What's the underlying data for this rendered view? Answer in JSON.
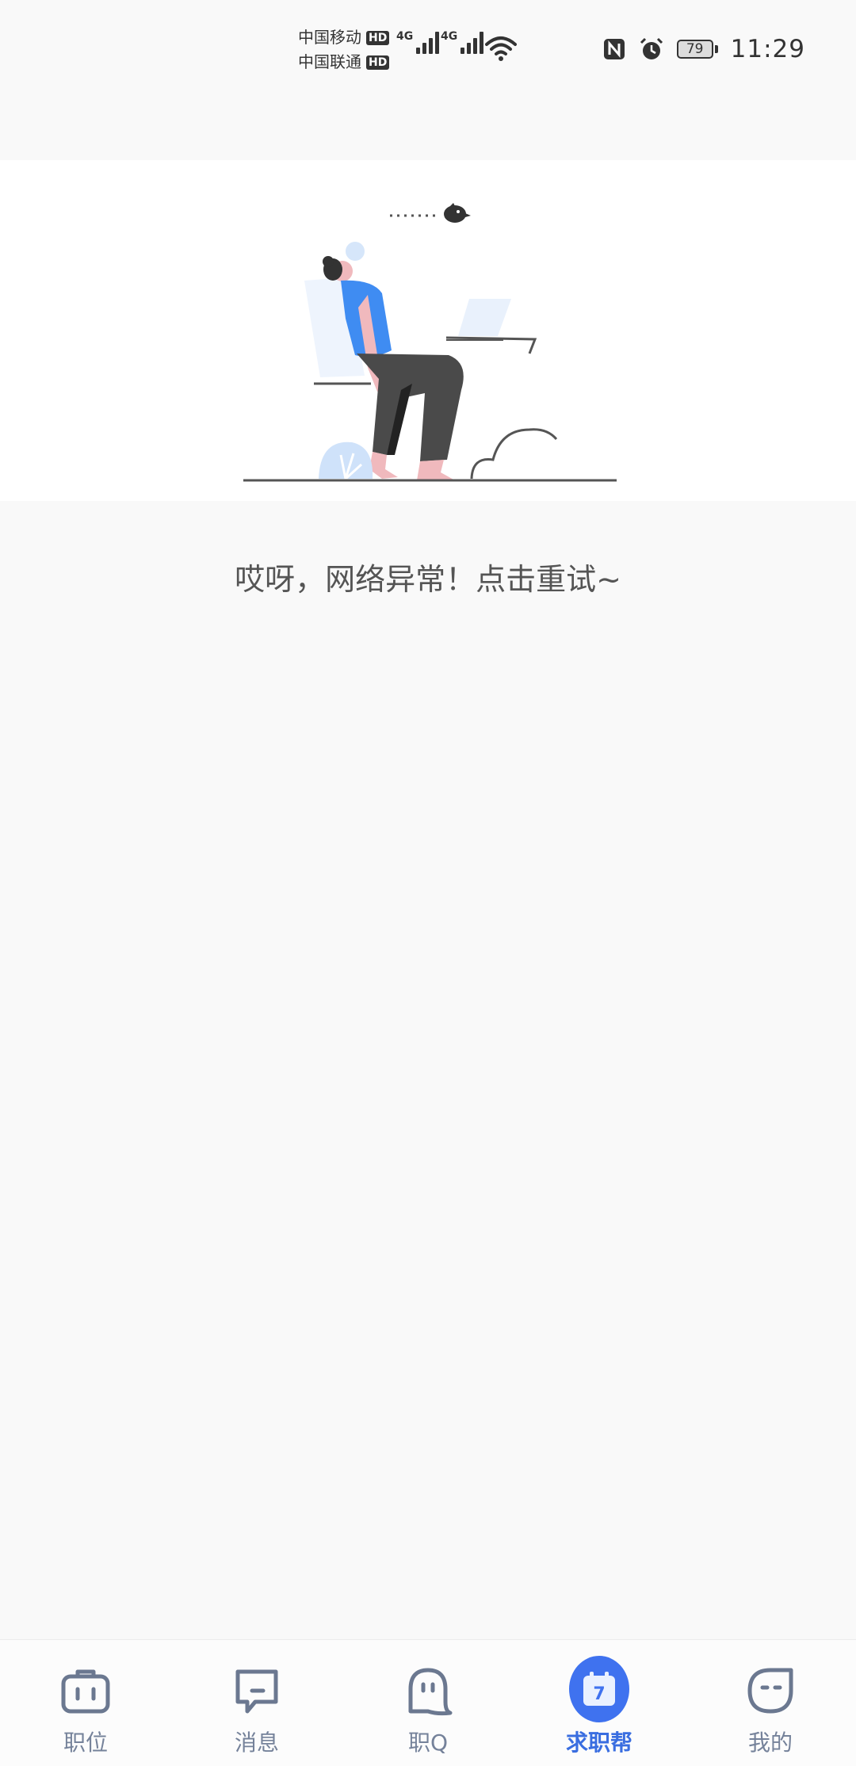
{
  "status_bar": {
    "carrier1": "中国移动",
    "carrier2": "中国联通",
    "hd": "HD",
    "net1": "4G",
    "net2": "4G",
    "battery": "79",
    "time": "11:29"
  },
  "main": {
    "error_message": "哎呀，网络异常！点击重试~"
  },
  "tabs": [
    {
      "label": "职位",
      "icon": "briefcase-icon"
    },
    {
      "label": "消息",
      "icon": "message-icon"
    },
    {
      "label": "职Q",
      "icon": "ghost-icon"
    },
    {
      "label": "求职帮",
      "icon": "calendar-icon",
      "badge": "7",
      "active": true
    },
    {
      "label": "我的",
      "icon": "face-icon"
    }
  ],
  "colors": {
    "accent": "#3f72ef",
    "tab_inactive": "#75829a",
    "shirt": "#3f8cf2",
    "pants": "#4a4a4a"
  }
}
